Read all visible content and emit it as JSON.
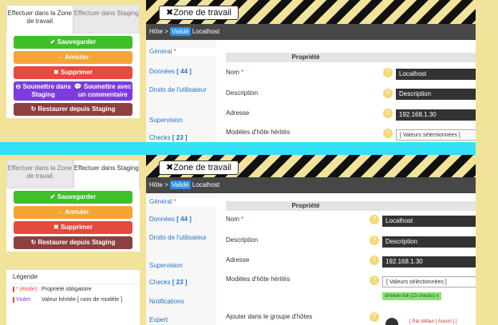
{
  "tabs": {
    "staging_top_left": "Effectuer dans la Zone de travail",
    "staging_top_right": "Effectuer dans Staging",
    "bottom_left": "Effectuer dans la Zone de travail",
    "bottom_right": "Effectuer dans Staging"
  },
  "buttons": {
    "save": "✔ Sauvegarder",
    "cancel": "← Annuler",
    "delete": "✖ Supprimer",
    "submit_staging": "⊖ Soumettre dans Staging",
    "submit_comment": "💬 Soumettre avec un commentaire",
    "restore": "↻ Restaurer depuis Staging"
  },
  "header": {
    "zone_title": "✖Zone de travail",
    "crumb_prefix": "Hôte > ",
    "crumb_badge": "Validé",
    "crumb_host": " Localhost"
  },
  "nav": {
    "general": "Général",
    "donnees": "Données",
    "donnees_count": "[ 44 ]",
    "droits": "Droits de l'utilisateur",
    "supervision": "Supervision",
    "checks": "Checks",
    "checks_count": "[ 23 ]",
    "notifications": "Notifications",
    "expert": "Expert"
  },
  "table": {
    "header": "Propriété",
    "rows": {
      "nom": "Nom",
      "description": "Description",
      "adresse": "Adresse",
      "modeles": "Modèles d'hôte hérités",
      "groupe": "Ajouter dans le groupe d'hôtes"
    },
    "values": {
      "nom": "Localhost",
      "description": "Description",
      "adresse": "192.168.1.30",
      "modeles": "[ Valeurs sélectionnées ]",
      "tag": "shinken-full (23 checks) x",
      "default": "[ Par défaut [ Aucun ] ]"
    }
  },
  "legend": {
    "title": "Légende",
    "star_key": "* (étoile):",
    "star_val": "Propriété obligatoire",
    "violet_key": "Violet:",
    "violet_val": "Valeur héritée [ nom de modèle ]"
  },
  "colors": {
    "background": "#f2e39a",
    "band": "#33e0f5",
    "green": "#3fbf29",
    "orange": "#f6a436",
    "red": "#e6493d",
    "purple": "#7d3ce0",
    "brown": "#8e3f3f"
  }
}
